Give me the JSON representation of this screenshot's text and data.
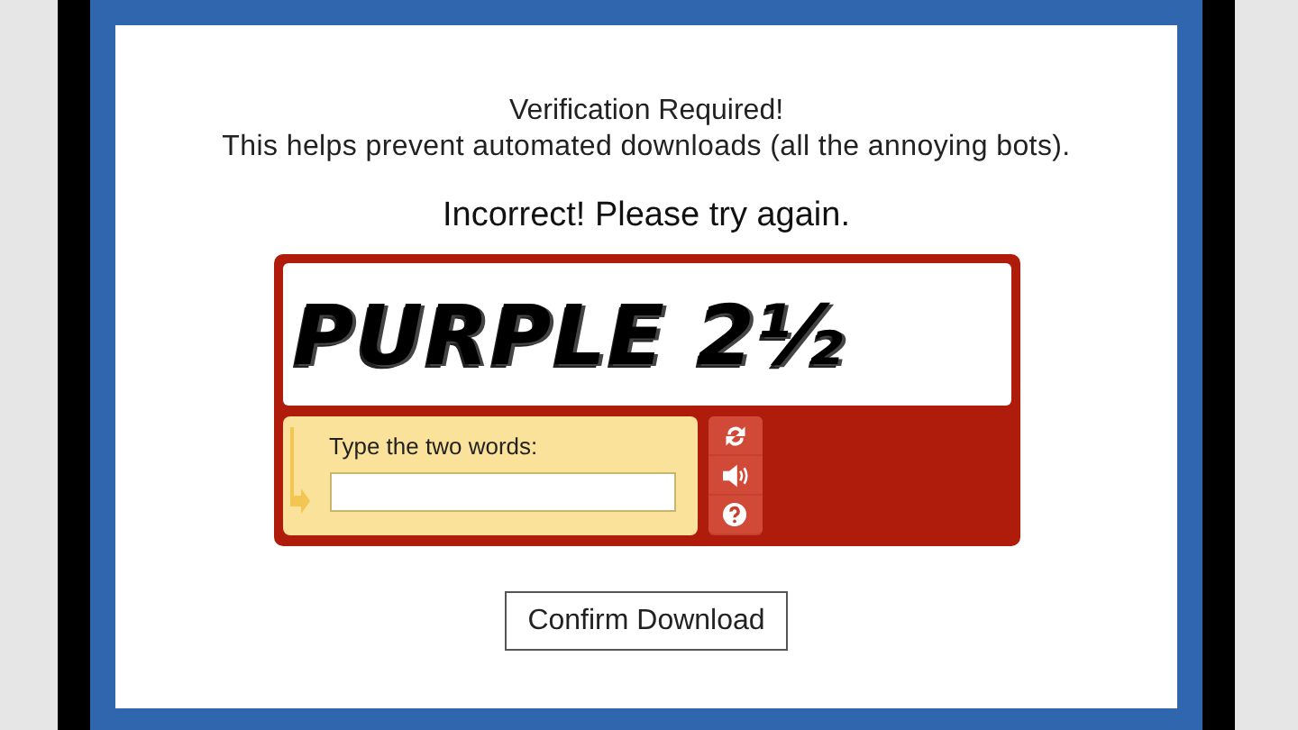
{
  "heading": "Verification Required!",
  "message": "This helps prevent automated downloads (all the annoying bots).",
  "error": "Incorrect! Please try again.",
  "captcha": {
    "challenge": "PURPLE 2½",
    "prompt": "Type the two words:"
  },
  "buttons": [
    "Confirm Download"
  ]
}
